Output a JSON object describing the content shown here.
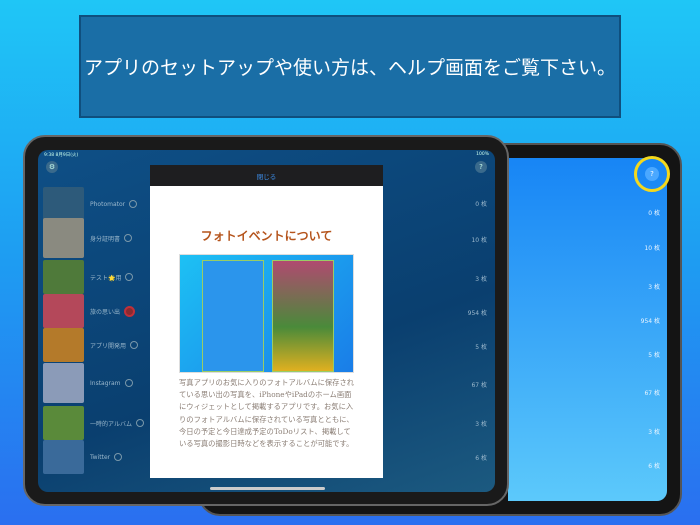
{
  "banner": {
    "text": "アプリのセットアップや使い方は、ヘルプ画面をご覧下さい。"
  },
  "status": {
    "time": "9:38 8月9日(火)",
    "battery": "100%"
  },
  "modal": {
    "close_label": "閉じる",
    "title": "フォトイベントについて",
    "body": "写真アプリのお気に入りのフォトアルバムに保存されている思い出の写真を、iPhoneやiPadのホーム画面にウィジェットとして掲載するアプリです。お気に入りのフォトアルバムに保存されている写真とともに、今日の予定と今日達成予定のToDoリスト、掲載している写真の撮影日時などを表示することが可能です。"
  },
  "albums": [
    {
      "name": "Photomator",
      "count": "0 枚",
      "color": "#2d5a7a"
    },
    {
      "name": "身分証明書",
      "count": "10 枚",
      "color": "#8a8a80"
    },
    {
      "name": "テスト🌟用",
      "count": "3 枚",
      "color": "#4f7a3a"
    },
    {
      "name": "旅の思い出",
      "count": "954 枚",
      "color": "#b4485a"
    },
    {
      "name": "アプリ開発用",
      "count": "5 枚",
      "color": "#b47a2a"
    },
    {
      "name": "Instagram",
      "count": "67 枚",
      "color": "#8b9bb8"
    },
    {
      "name": "一時的アルバム",
      "count": "3 枚",
      "color": "#5a8a3a"
    },
    {
      "name": "Twitter",
      "count": "6 枚",
      "color": "#3a6a9a"
    }
  ],
  "colors": {
    "accent": "#f4d81c",
    "title": "#b5541c"
  }
}
